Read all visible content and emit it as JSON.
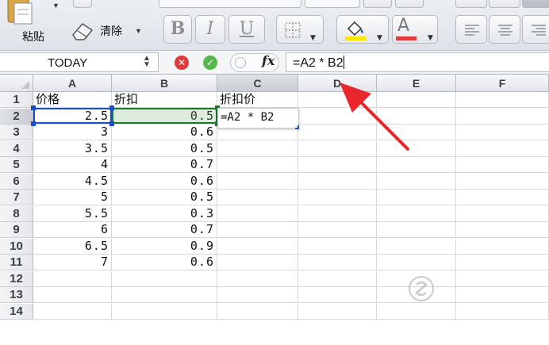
{
  "ribbon": {
    "paste_label": "粘贴",
    "clear_label": "清除",
    "bold_label": "B",
    "italic_label": "I",
    "underline_label": "U",
    "font_color_label": "A"
  },
  "formula_bar": {
    "name_box": "TODAY",
    "fx_label": "fx",
    "formula": "=A2 * B2"
  },
  "columns": [
    "A",
    "B",
    "C",
    "D",
    "E",
    "F"
  ],
  "rows": [
    "1",
    "2",
    "3",
    "4",
    "5",
    "6",
    "7",
    "8",
    "9",
    "10",
    "11",
    "12",
    "13",
    "14"
  ],
  "cells": {
    "A1": "价格",
    "B1": "折扣",
    "C1": "折扣价",
    "A2": "2.5",
    "B2": "0.5",
    "A3": "3",
    "B3": "0.6",
    "A4": "3.5",
    "B4": "0.5",
    "A5": "4",
    "B5": "0.7",
    "A6": "4.5",
    "B6": "0.6",
    "A7": "5",
    "B7": "0.5",
    "A8": "5.5",
    "B8": "0.3",
    "A9": "6",
    "B9": "0.7",
    "A10": "6.5",
    "B10": "0.9",
    "A11": "7",
    "B11": "0.6"
  },
  "editing_cell": {
    "ref": "C2",
    "content": "=A2 * B2"
  },
  "selection": {
    "active_column": "C",
    "active_row": "2"
  },
  "colors": {
    "ref_a2": "#1c4fc4",
    "ref_b2": "#1a7a2a",
    "arrow": "#e8262b"
  }
}
